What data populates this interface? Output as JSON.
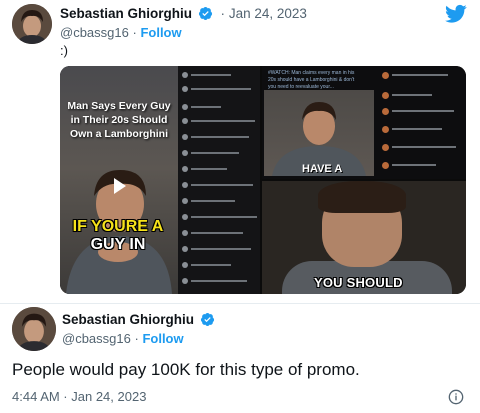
{
  "tweet1": {
    "author_name": "Sebastian Ghiorghiu",
    "separator": "·",
    "date": "Jan 24, 2023",
    "handle": "@cbassg16",
    "dot": "·",
    "follow_label": "Follow",
    "text": ":)",
    "media": {
      "left_video_title": "Man Says Every Guy in Their 20s Should Own a Lamborghini",
      "left_caption_line1": "IF YOURE A",
      "left_caption_line2": "GUY IN",
      "top_right_text": "#WATCH: Man claims every man in his 20s should have a Lamborghini & don't you need to reevaluate your...",
      "top_right_caption": "HAVE A",
      "bottom_right_caption": "YOU SHOULD"
    }
  },
  "tweet2": {
    "author_name": "Sebastian Ghiorghiu",
    "handle": "@cbassg16",
    "dot": "·",
    "follow_label": "Follow",
    "text": "People would pay 100K for this type of promo.",
    "timestamp": "4:44 AM · Jan 24, 2023"
  },
  "colors": {
    "accent": "#1d9bf0",
    "text": "#0f1419",
    "muted": "#536471"
  },
  "icons": {
    "twitter_logo": "twitter-bird-icon",
    "verified": "verified-badge-icon",
    "info": "info-icon",
    "play": "play-icon"
  }
}
